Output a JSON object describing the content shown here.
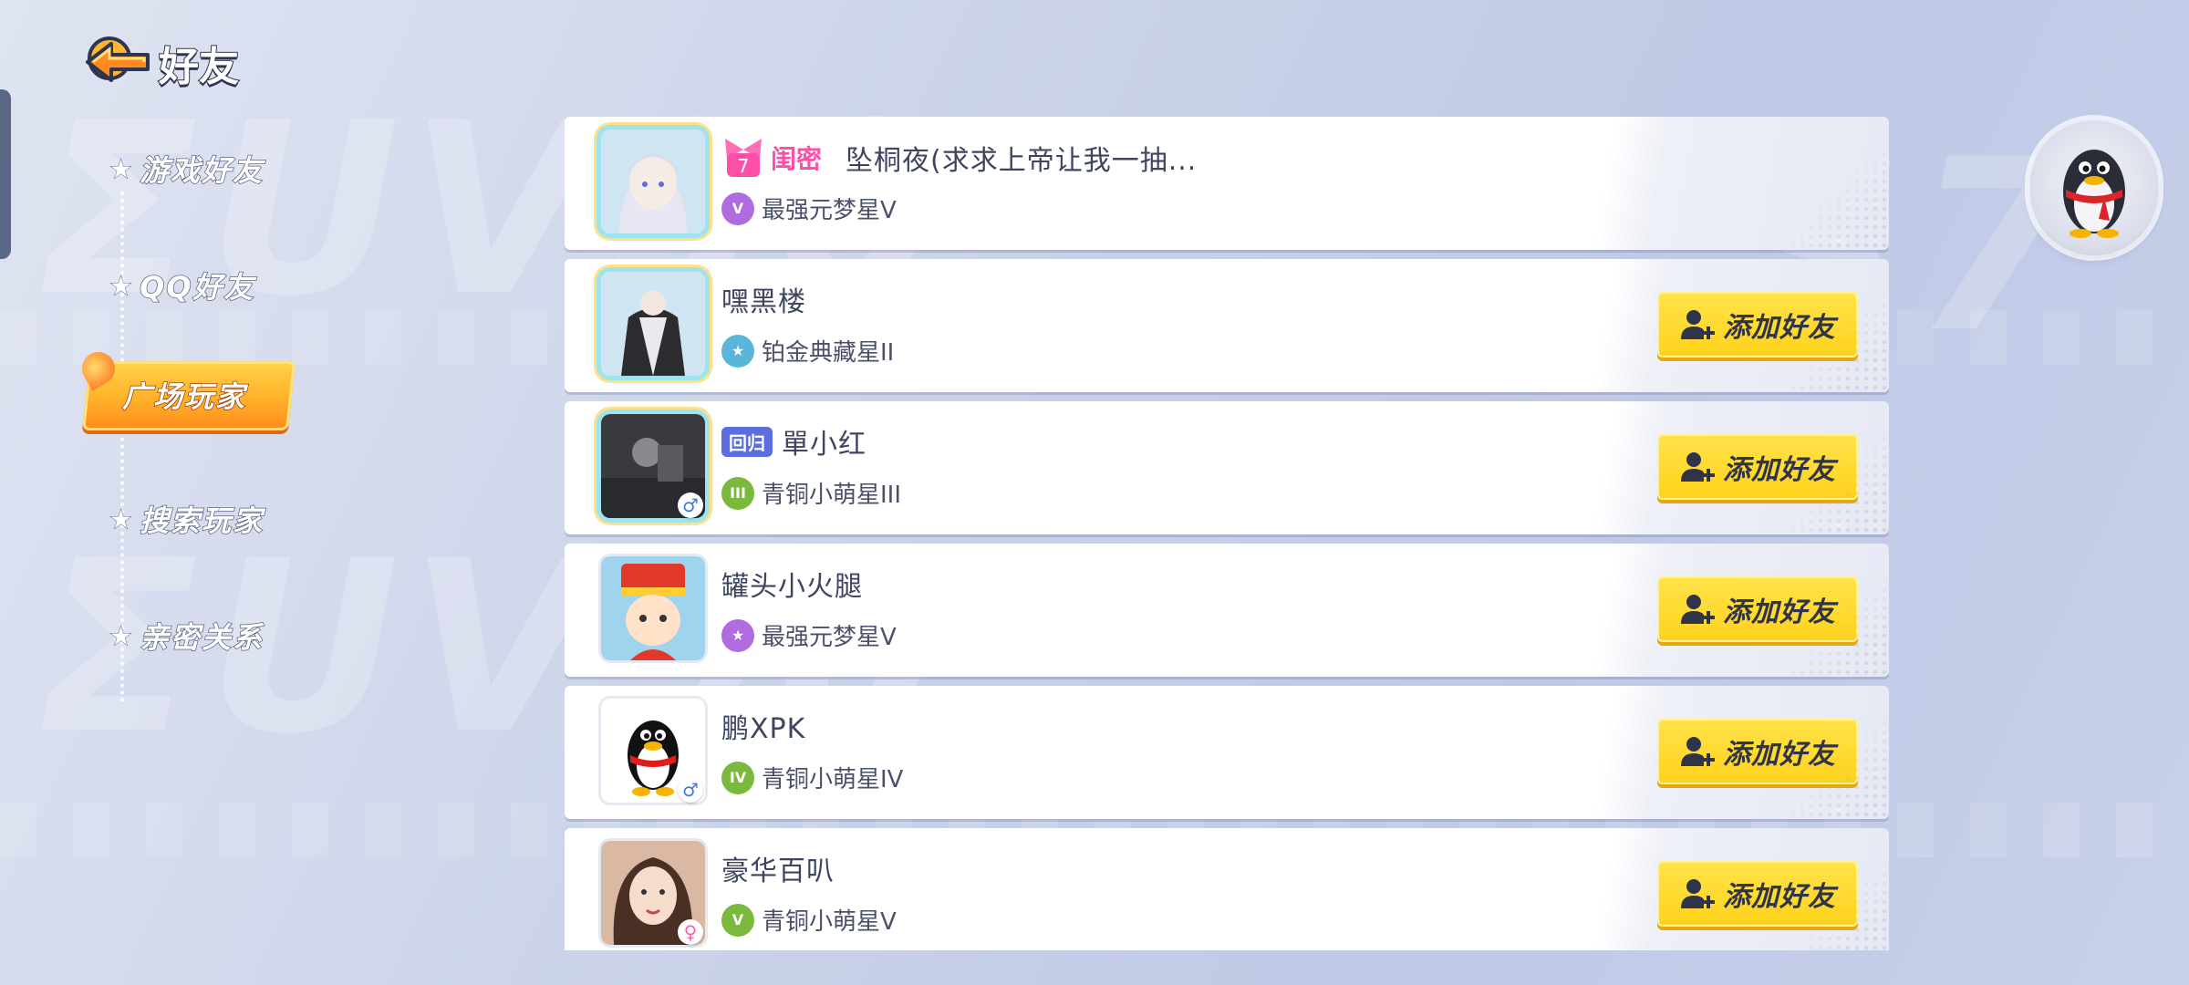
{
  "header": {
    "title": "好友",
    "back_icon": "back-arrow-icon"
  },
  "sidebar": {
    "items": [
      {
        "label": "游戏好友",
        "active": false
      },
      {
        "label": "QQ好友",
        "active": false
      },
      {
        "label": "广场玩家",
        "active": true
      },
      {
        "label": "搜索玩家",
        "active": false
      },
      {
        "label": "亲密关系",
        "active": false
      }
    ]
  },
  "players": [
    {
      "name": "坠桐夜(求求上帝让我一抽...",
      "tag": {
        "type": "intimacy",
        "level": "7",
        "text": "闺密"
      },
      "rank": "最强元梦星V",
      "rank_color": "#b06be0",
      "rank_mark": "V",
      "gender": null,
      "show_add": false
    },
    {
      "name": "嘿黑楼",
      "tag": null,
      "rank": "铂金典藏星II",
      "rank_color": "#5ab6d8",
      "rank_mark": "★",
      "gender": null,
      "show_add": true
    },
    {
      "name": "單小红",
      "tag": {
        "type": "return",
        "text": "回归"
      },
      "rank": "青铜小萌星III",
      "rank_color": "#7bb83e",
      "rank_mark": "III",
      "gender": "male",
      "show_add": true
    },
    {
      "name": "罐头小火腿",
      "tag": null,
      "rank": "最强元梦星V",
      "rank_color": "#b06be0",
      "rank_mark": "★",
      "gender": null,
      "show_add": true
    },
    {
      "name": "鹏XPK",
      "tag": null,
      "rank": "青铜小萌星IV",
      "rank_color": "#7bb83e",
      "rank_mark": "IV",
      "gender": "male",
      "show_add": true
    },
    {
      "name": "豪华百叭",
      "tag": null,
      "rank": "青铜小萌星V",
      "rank_color": "#7bb83e",
      "rank_mark": "V",
      "gender": "female",
      "show_add": true
    }
  ],
  "add_button_label": "添加好友",
  "gender_symbols": {
    "male": "♂",
    "female": "♀"
  },
  "qq_button_icon": "qq-penguin-icon"
}
